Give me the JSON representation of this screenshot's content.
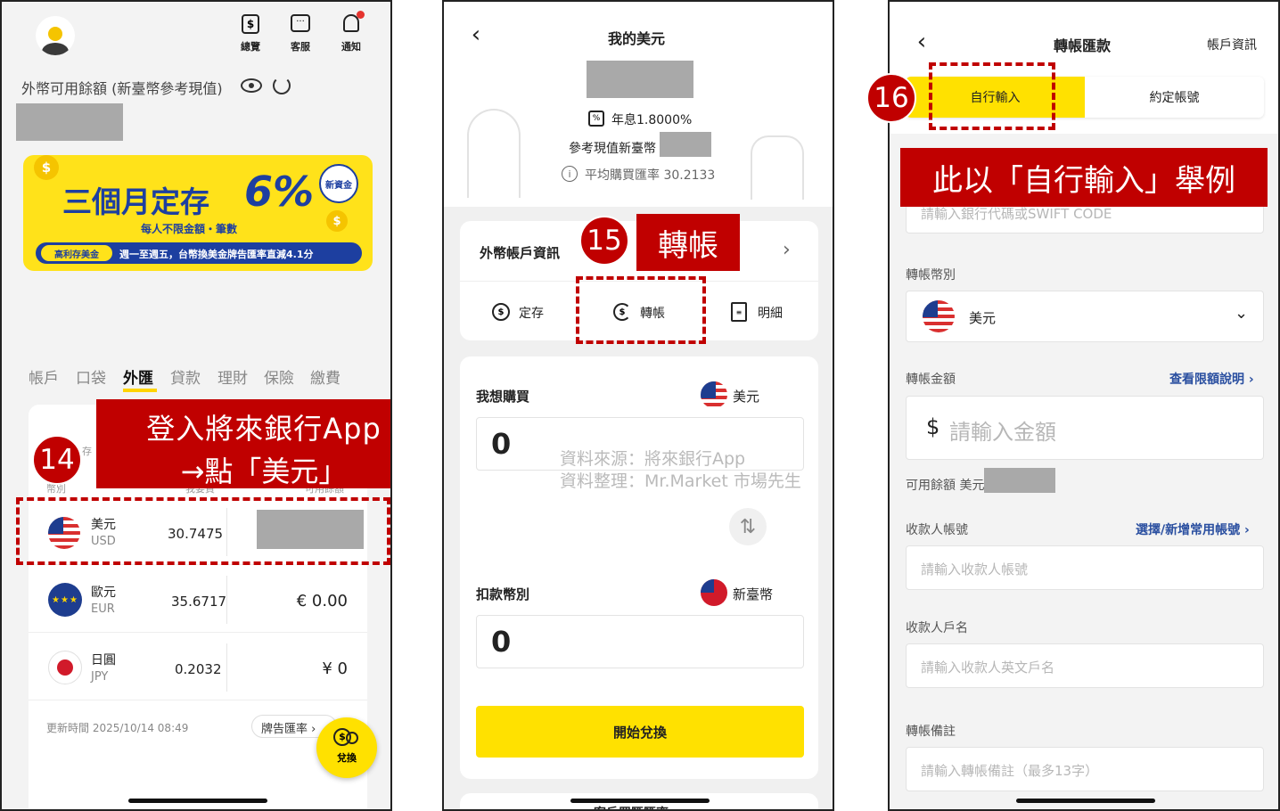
{
  "screen1": {
    "nav": {
      "overview": "總覽",
      "service": "客服",
      "notify": "通知"
    },
    "balance_label": "外幣可用餘額 (新臺幣參考現值)",
    "banner": {
      "title": "三個月定存",
      "rate": "6%",
      "tag": "新資金",
      "subtitle": "每人不限金額・筆數",
      "strip_tag": "高利存美金",
      "strip_text": "週一至週五，台幣換美金牌告匯率直減4.1分"
    },
    "tabs": [
      "帳戶",
      "口袋",
      "外匯",
      "貸款",
      "理財",
      "保險",
      "繳費"
    ],
    "columns": {
      "currency": "幣別",
      "rate": "我要買",
      "avail": "可用餘額"
    },
    "col_peek": "存",
    "rows": [
      {
        "name": "美元",
        "code": "USD",
        "rate": "30.7475",
        "amount": ""
      },
      {
        "name": "歐元",
        "code": "EUR",
        "rate": "35.6717",
        "amount": "€ 0.00"
      },
      {
        "name": "日圓",
        "code": "JPY",
        "rate": "0.2032",
        "amount": "¥ 0"
      }
    ],
    "update_time": "更新時間 2025/10/14 08:49",
    "board_rate": "牌告匯率",
    "exchange_btn": "兌換",
    "annotation_num": "14",
    "annotation_line1": "登入將來銀行App",
    "annotation_line2": "→點「美元」"
  },
  "screen2": {
    "title": "我的美元",
    "rate_line": "年息1.8000%",
    "ref_value": "參考現值新臺幣",
    "avg_rate": "平均購買匯率 30.2133",
    "account_info": "外幣帳戶資訊",
    "actions": {
      "deposit": "定存",
      "transfer": "轉帳",
      "detail": "明細"
    },
    "buy_label": "我想購買",
    "buy_currency": "美元",
    "buy_value": "0",
    "deduct_label": "扣款幣別",
    "deduct_currency": "新臺幣",
    "deduct_value": "0",
    "start_btn": "開始兌換",
    "bottom_peek": "客戶買匯匯率",
    "watermark1": "資料來源：將來銀行App",
    "watermark2": "資料整理：Mr.Market 市場先生",
    "annotation_num": "15",
    "annotation_text": "轉帳"
  },
  "screen3": {
    "title": "轉帳匯款",
    "header_right": "帳戶資訊",
    "seg_self": "自行輸入",
    "seg_agreed": "約定帳號",
    "swift_ph": "請輸入銀行代碼或SWIFT CODE",
    "currency_label": "轉帳幣別",
    "currency_value": "美元",
    "amount_label": "轉帳金額",
    "limit_link": "查看限額說明",
    "amount_ph": "請輸入金額",
    "avail_label": "可用餘額 美元",
    "payee_acct_label": "收款人帳號",
    "payee_acct_link": "選擇/新增常用帳號",
    "payee_acct_ph": "請輸入收款人帳號",
    "payee_name_label": "收款人戶名",
    "payee_name_ph": "請輸入收款人英文戶名",
    "memo_label": "轉帳備註",
    "memo_ph": "請輸入轉帳備註（最多13字）",
    "annotation_num": "16",
    "annotation_text": "此以「自行輸入」舉例"
  },
  "colors": {
    "accent": "#ffe100",
    "annotation": "#c00000",
    "link": "#2a4fa0"
  }
}
